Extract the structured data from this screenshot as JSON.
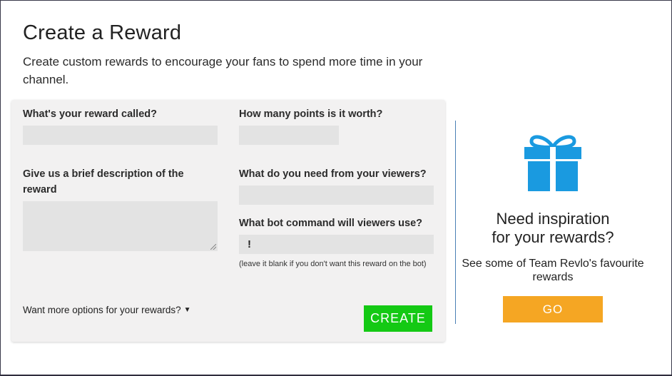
{
  "header": {
    "title": "Create a Reward",
    "subtitle": "Create custom rewards to encourage your fans to spend more time in your channel."
  },
  "form": {
    "name_label": "What's your reward called?",
    "name_value": "",
    "points_label": "How many points is it worth?",
    "points_value": "",
    "description_label": "Give us a brief description of the reward",
    "description_value": "",
    "viewer_input_label": "What do you need from your viewers?",
    "viewer_input_value": "",
    "bot_command_label": "What bot command will viewers use?",
    "bot_command_prefix": "!",
    "bot_command_value": "",
    "bot_command_hint": "(leave it blank if you don't want this reward on the bot)",
    "more_options_label": "Want more options for your rewards?",
    "create_label": "CREATE"
  },
  "inspiration": {
    "icon": "gift-icon",
    "title_line1": "Need inspiration",
    "title_line2": "for your rewards?",
    "text": "See some of Team Revlo's favourite rewards",
    "go_label": "GO"
  },
  "colors": {
    "create_button": "#14c914",
    "go_button": "#f5a623",
    "gift_icon": "#1a9ae0",
    "form_background": "#f2f1f1",
    "input_background": "#e3e3e3",
    "divider": "#4a7fb5"
  }
}
